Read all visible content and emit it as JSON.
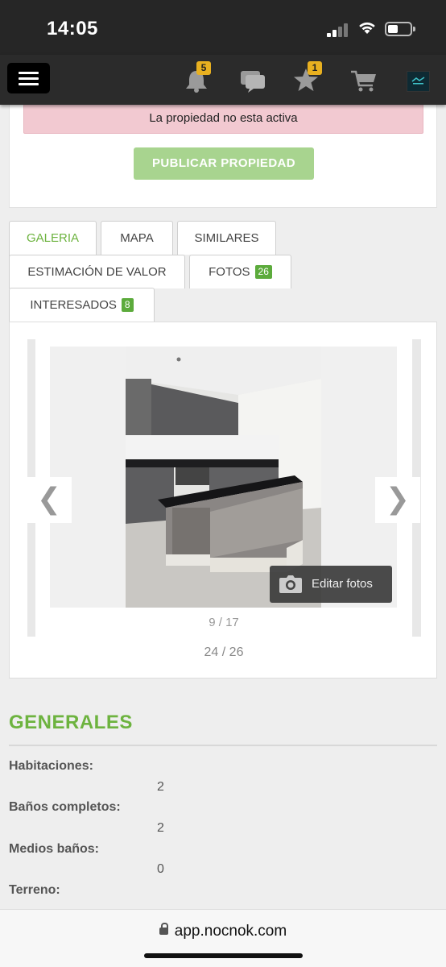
{
  "status_bar": {
    "time": "14:05"
  },
  "header": {
    "notifications_count": "5",
    "favorites_count": "1",
    "icons": [
      "menu-icon",
      "bell-icon",
      "chat-icon",
      "star-icon",
      "cart-icon",
      "logo"
    ]
  },
  "alert": {
    "text": "La propiedad no esta activa"
  },
  "publish_button": {
    "label": "PUBLICAR PROPIEDAD"
  },
  "tabs": [
    {
      "label": "GALERIA",
      "active": true
    },
    {
      "label": "MAPA"
    },
    {
      "label": "SIMILARES"
    },
    {
      "label": "ESTIMACIÓN DE VALOR"
    },
    {
      "label": "FOTOS",
      "count": "26"
    },
    {
      "label": "INTERESADOS",
      "count": "8"
    }
  ],
  "gallery": {
    "prev": "❮",
    "next": "❯",
    "edit_photos": "Editar fotos",
    "inner_counter": "9 / 17",
    "outer_counter": "24 / 26"
  },
  "generales": {
    "title": "GENERALES",
    "specs": [
      {
        "label": "Habitaciones:",
        "value": "2"
      },
      {
        "label": "Baños completos:",
        "value": "2"
      },
      {
        "label": "Medios baños:",
        "value": "0"
      },
      {
        "label": "Terreno:",
        "value": ""
      }
    ]
  },
  "browser": {
    "url": "app.nocnok.com"
  },
  "colors": {
    "accent": "#6db33f",
    "badge": "#e8b020",
    "alert_bg": "#f2c9d1"
  }
}
